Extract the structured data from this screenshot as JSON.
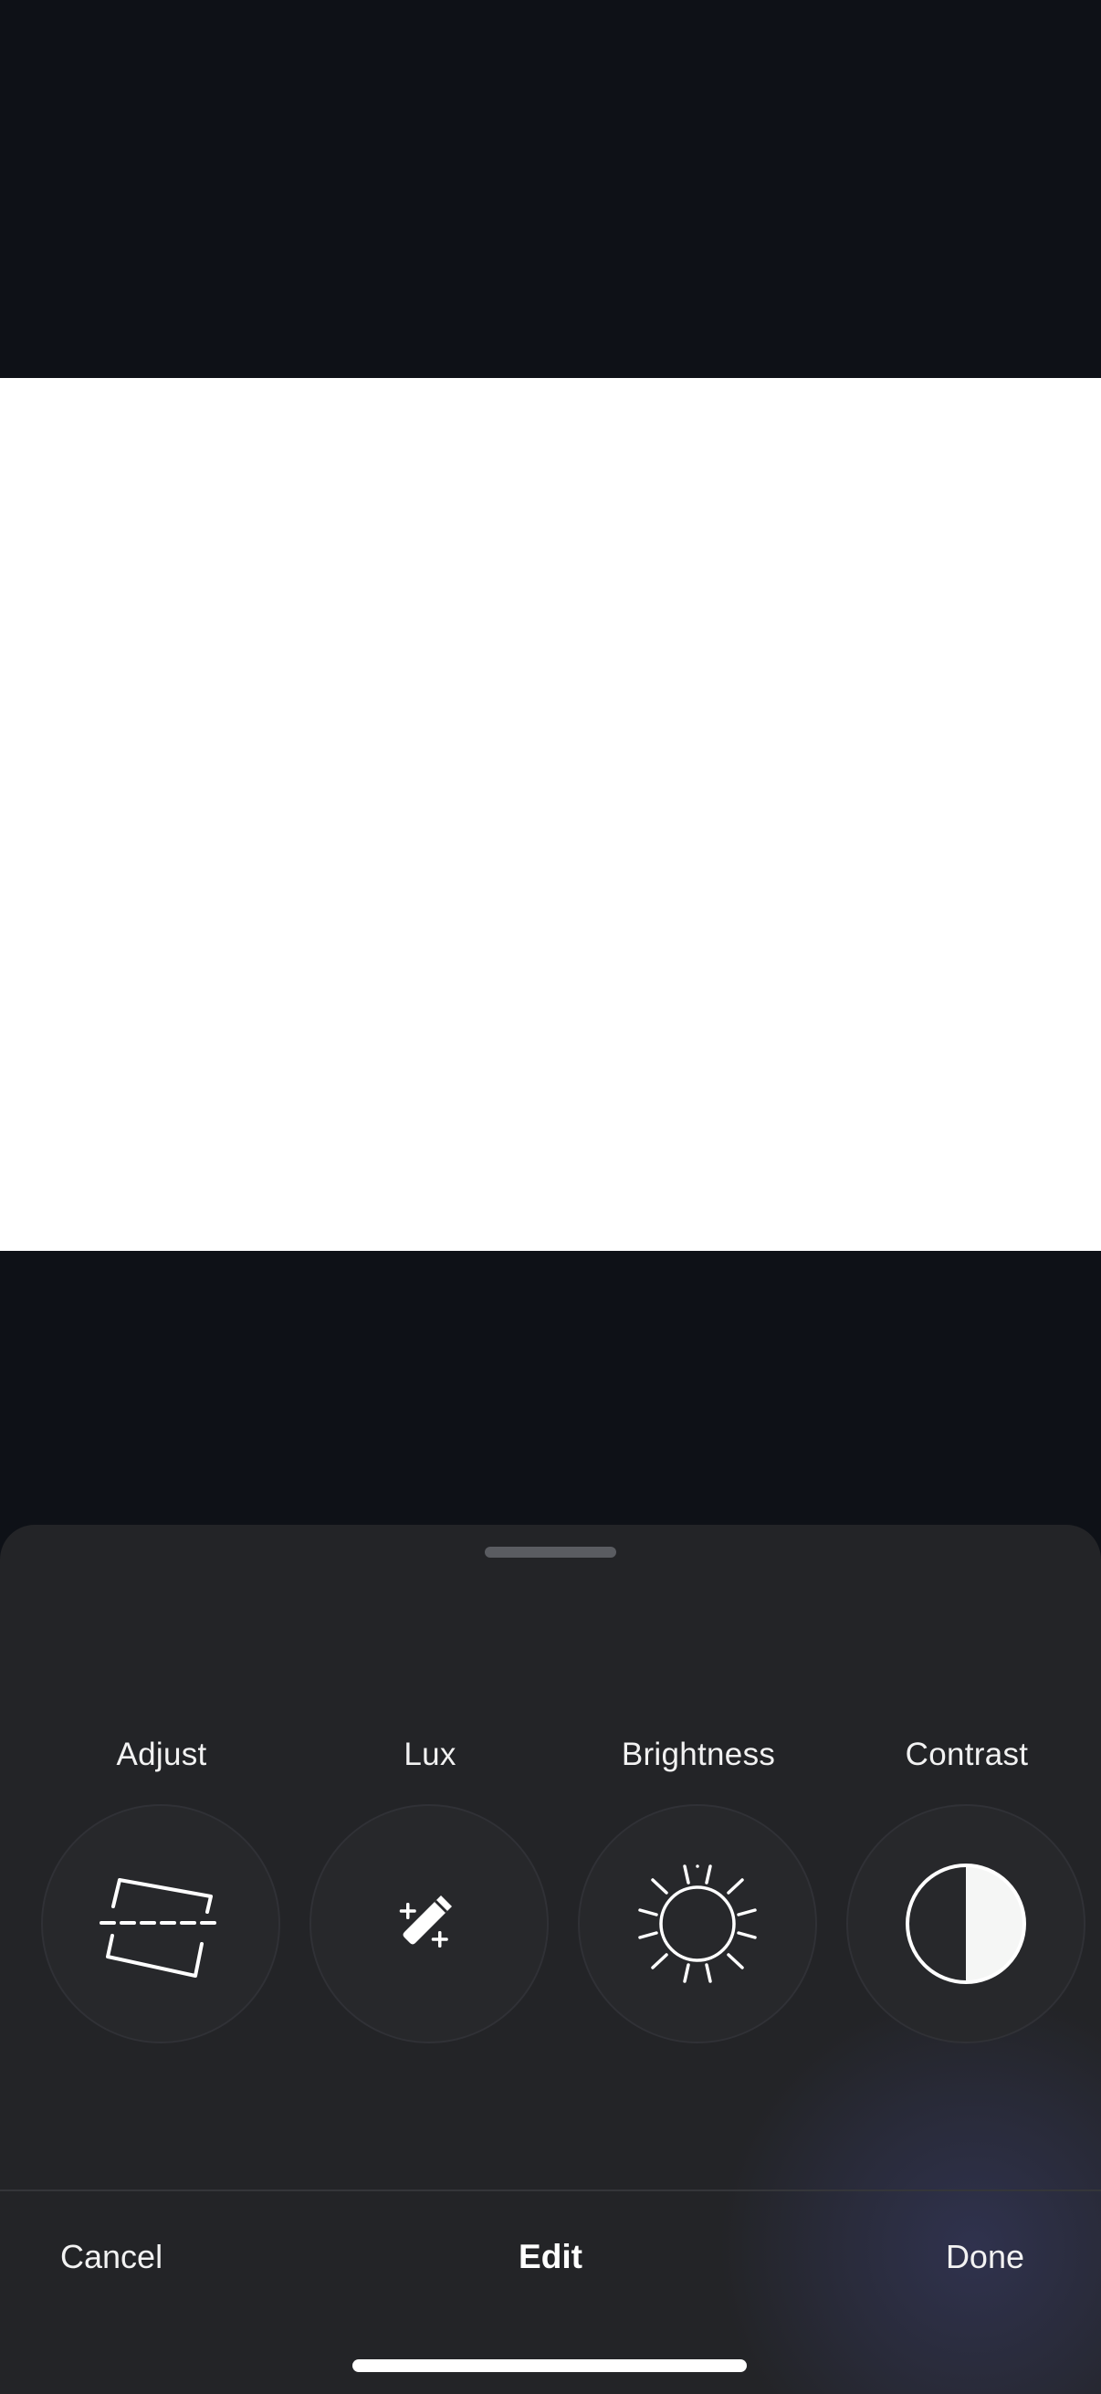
{
  "editor": {
    "title": "Edit",
    "cancel_label": "Cancel",
    "done_label": "Done"
  },
  "tools": [
    {
      "label": "Adjust",
      "icon": "adjust-straighten-icon"
    },
    {
      "label": "Lux",
      "icon": "magic-wand-icon"
    },
    {
      "label": "Brightness",
      "icon": "sun-icon"
    },
    {
      "label": "Contrast",
      "icon": "half-circle-icon"
    }
  ],
  "colors": {
    "background": "#0e1117",
    "sheet": "#232427",
    "text": "#f2f2f2",
    "photo": "#ffffff"
  }
}
